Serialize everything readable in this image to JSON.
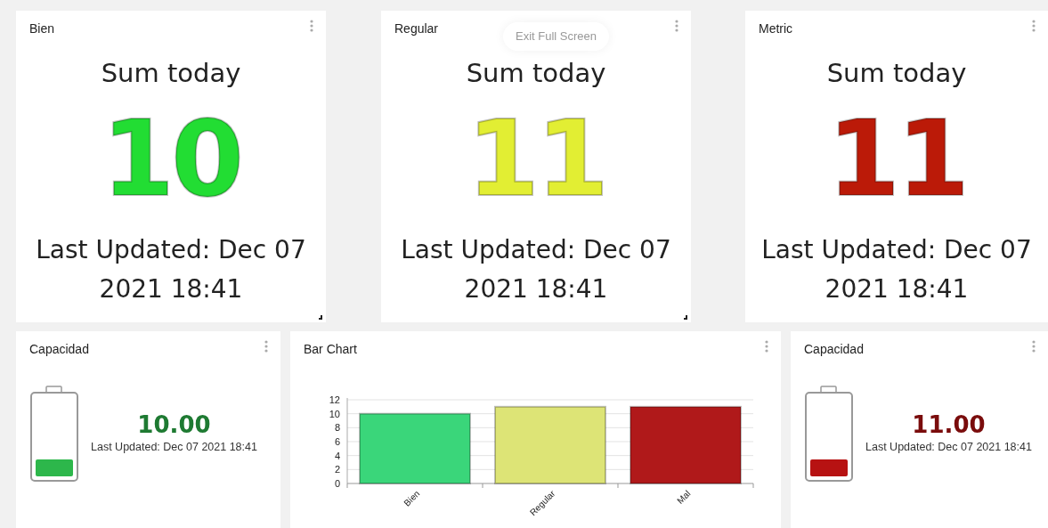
{
  "tooltip": {
    "text": "Exit Full Screen"
  },
  "metric_cards": [
    {
      "title": "Sum today",
      "header": "Bien",
      "value": "10",
      "color": "#22dd33",
      "updated_label": "Last Updated: Dec 07 2021 18:41"
    },
    {
      "title": "Sum today",
      "header": "Regular",
      "value": "11",
      "color": "#e2ee33",
      "updated_label": "Last Updated: Dec 07 2021 18:41"
    },
    {
      "title": "Sum today",
      "header": "Metric",
      "value": "11",
      "color": "#bb1a08",
      "updated_label": "Last Updated: Dec 07 2021 18:41"
    }
  ],
  "bottom_cards": [
    {
      "kind": "battery",
      "header": "Capacidad",
      "value": "10.00",
      "color": "#1e7a32",
      "level": 0.2,
      "updated_label": "Last Updated: Dec 07 2021 18:41"
    },
    {
      "kind": "chart",
      "header": "Bar Chart",
      "chart_data": {
        "type": "bar",
        "categories": [
          "Bien",
          "Regular",
          "Mal"
        ],
        "values": [
          10,
          11,
          11
        ],
        "colors": [
          "#3ad67a",
          "#dde476",
          "#b0191a"
        ],
        "grid": true,
        "ylim": [
          0,
          12
        ],
        "yticks": [
          0,
          2,
          4,
          6,
          8,
          10,
          12
        ]
      }
    },
    {
      "kind": "battery",
      "header": "Capacidad",
      "value": "11.00",
      "color": "#7a0c0c",
      "level": 0.2,
      "updated_label": "Last Updated: Dec 07 2021 18:41"
    }
  ]
}
